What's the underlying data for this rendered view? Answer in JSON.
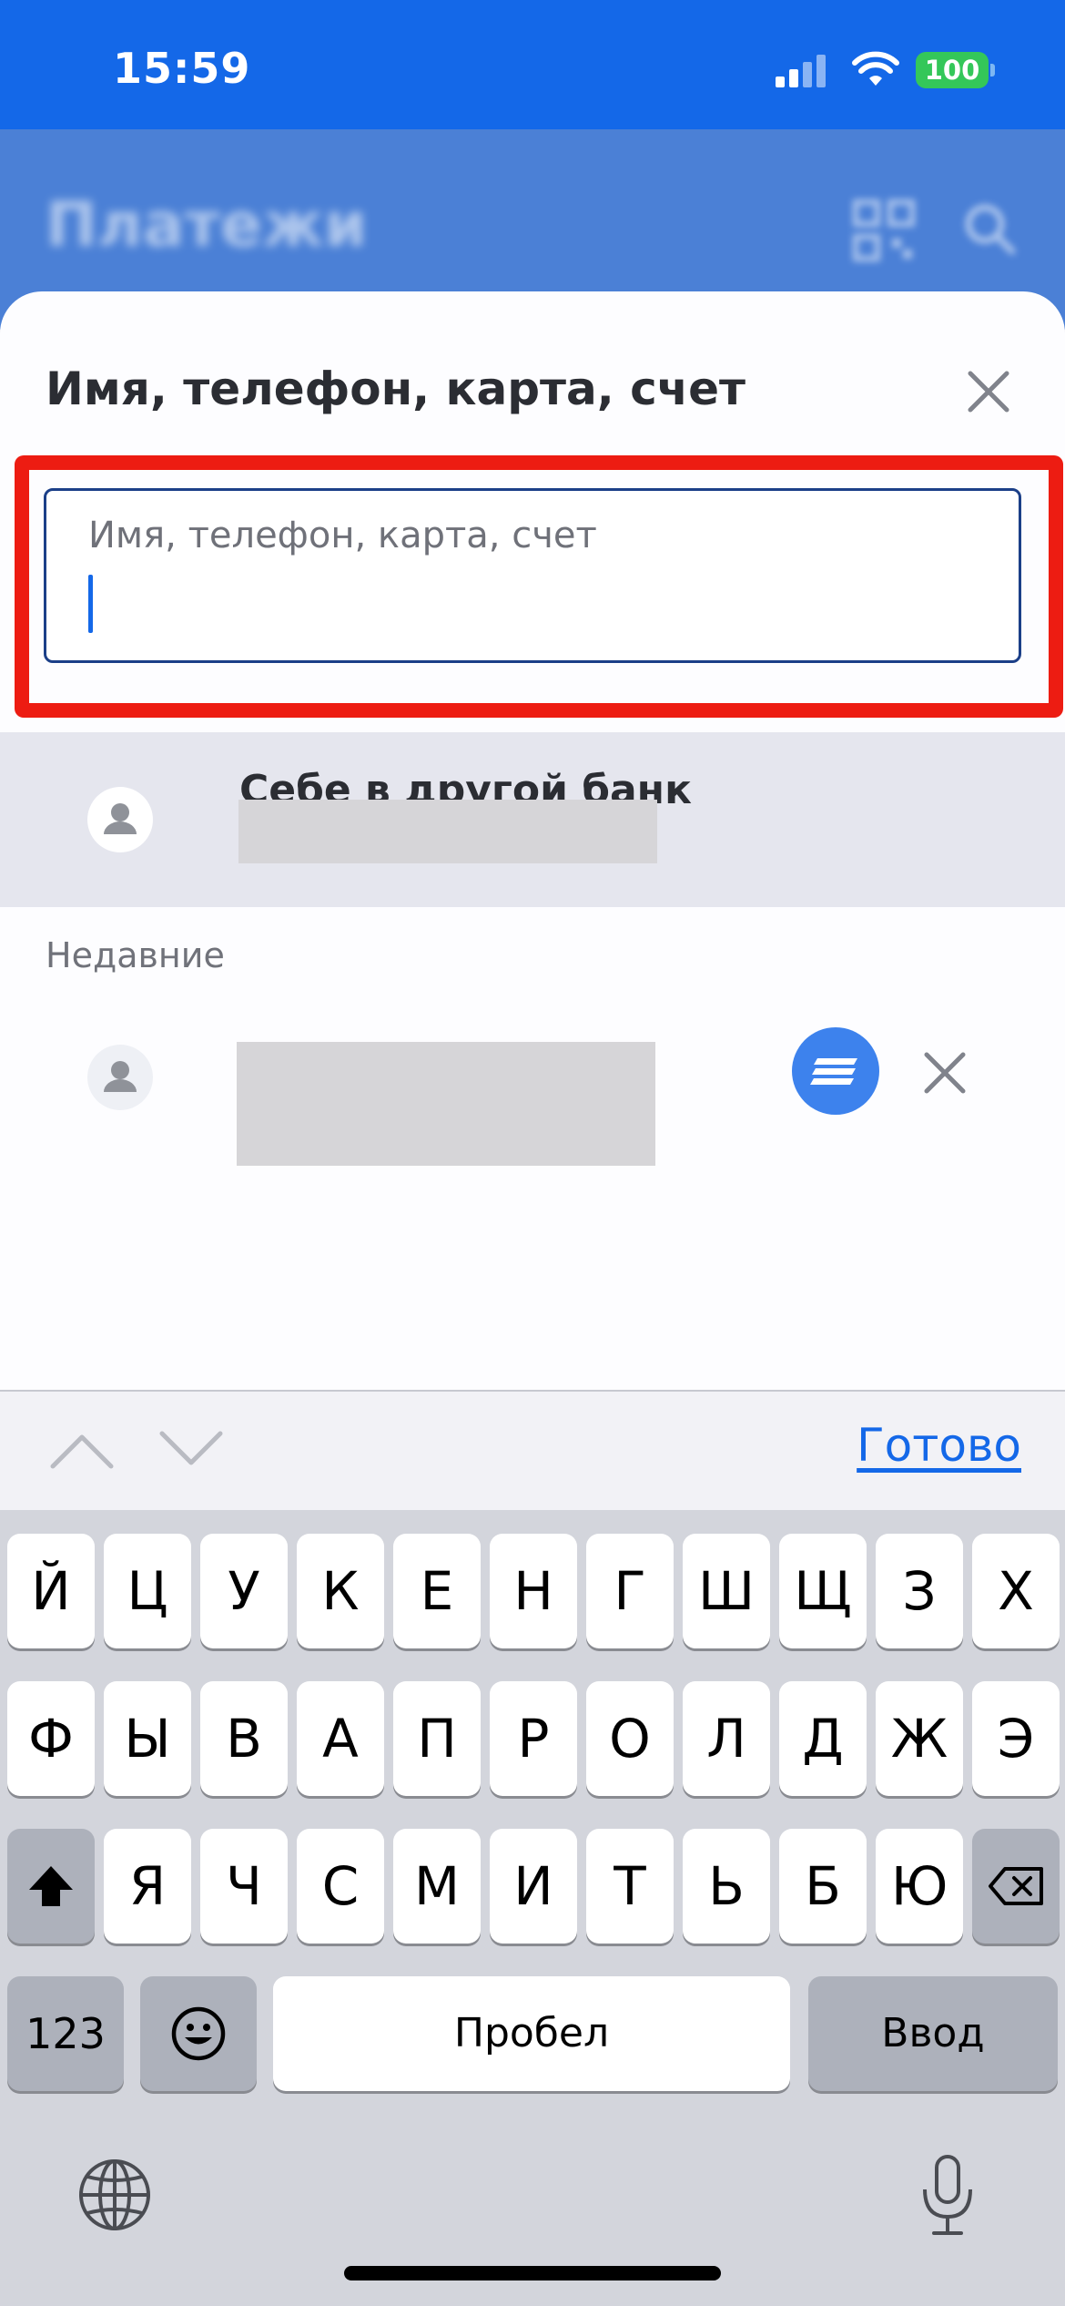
{
  "status_bar": {
    "time": "15:59",
    "battery": "100"
  },
  "header": {
    "title": "Платежи"
  },
  "sheet": {
    "title": "Имя, телефон, карта, счет",
    "search": {
      "label": "Имя, телефон, карта, счет",
      "value": ""
    },
    "self_transfer": {
      "title": "Себе в другой банк"
    },
    "recent_label": "Недавние"
  },
  "accessory": {
    "done_label": "Готово"
  },
  "keyboard": {
    "row1": [
      "Й",
      "Ц",
      "У",
      "К",
      "Е",
      "Н",
      "Г",
      "Ш",
      "Щ",
      "З",
      "Х"
    ],
    "row2": [
      "Ф",
      "Ы",
      "В",
      "А",
      "П",
      "Р",
      "О",
      "Л",
      "Д",
      "Ж",
      "Э"
    ],
    "row3": [
      "Я",
      "Ч",
      "С",
      "М",
      "И",
      "Т",
      "Ь",
      "Б",
      "Ю"
    ],
    "numbers_label": "123",
    "space_label": "Пробел",
    "enter_label": "Ввод"
  },
  "colors": {
    "accent": "#1468e8",
    "highlight": "#ed1c12",
    "status_bar": "#1468e8"
  }
}
